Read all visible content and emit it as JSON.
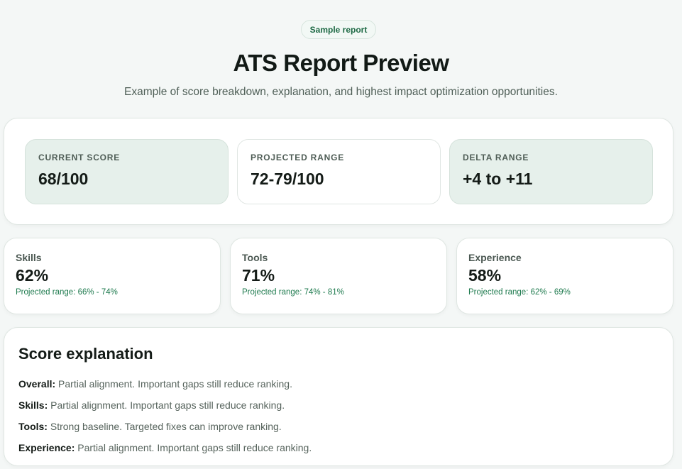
{
  "badge": "Sample report",
  "title": "ATS Report Preview",
  "subtitle": "Example of score breakdown, explanation, and highest impact optimization opportunities.",
  "summary": [
    {
      "label": "CURRENT SCORE",
      "value": "68/100"
    },
    {
      "label": "PROJECTED RANGE",
      "value": "72-79/100"
    },
    {
      "label": "DELTA RANGE",
      "value": "+4 to +11"
    }
  ],
  "categories": [
    {
      "name": "Skills",
      "pct": "62%",
      "projected": "Projected range: 66% - 74%"
    },
    {
      "name": "Tools",
      "pct": "71%",
      "projected": "Projected range: 74% - 81%"
    },
    {
      "name": "Experience",
      "pct": "58%",
      "projected": "Projected range: 62% - 69%"
    }
  ],
  "explanation": {
    "title": "Score explanation",
    "rows": [
      {
        "key": "Overall:",
        "text": " Partial alignment. Important gaps still reduce ranking."
      },
      {
        "key": "Skills:",
        "text": " Partial alignment. Important gaps still reduce ranking."
      },
      {
        "key": "Tools:",
        "text": " Strong baseline. Targeted fixes can improve ranking."
      },
      {
        "key": "Experience:",
        "text": " Partial alignment. Important gaps still reduce ranking."
      }
    ]
  }
}
